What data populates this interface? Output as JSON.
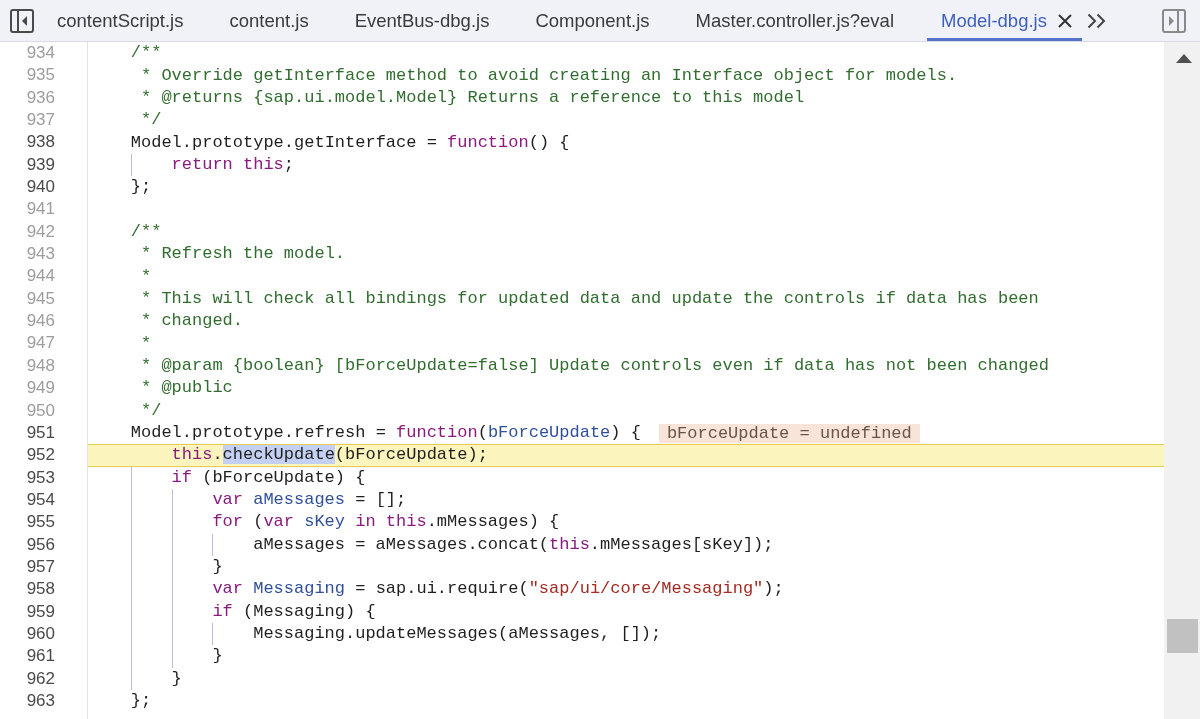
{
  "tabs": [
    {
      "label": "contentScript.js",
      "selected": false
    },
    {
      "label": "content.js",
      "selected": false
    },
    {
      "label": "EventBus-dbg.js",
      "selected": false
    },
    {
      "label": "Component.js",
      "selected": false
    },
    {
      "label": "Master.controller.js?eval",
      "selected": false
    },
    {
      "label": "Model-dbg.js",
      "selected": true
    }
  ],
  "editor": {
    "lines": [
      {
        "number": "934",
        "dimmed": true,
        "current": false,
        "code": [
          {
            "kind": "comment",
            "text": "    /**"
          }
        ]
      },
      {
        "number": "935",
        "dimmed": true,
        "current": false,
        "code": [
          {
            "kind": "comment",
            "text": "     * Override getInterface method to avoid creating an Interface object for models."
          }
        ]
      },
      {
        "number": "936",
        "dimmed": true,
        "current": false,
        "code": [
          {
            "kind": "comment",
            "text": "     * @returns {sap.ui.model.Model} Returns a reference to this model"
          }
        ]
      },
      {
        "number": "937",
        "dimmed": true,
        "current": false,
        "code": [
          {
            "kind": "comment",
            "text": "     */"
          }
        ]
      },
      {
        "number": "938",
        "dimmed": false,
        "current": false,
        "code": [
          {
            "kind": "plain",
            "text": "    Model.prototype.getInterface = "
          },
          {
            "kind": "keyword",
            "text": "function"
          },
          {
            "kind": "plain",
            "text": "() {"
          }
        ]
      },
      {
        "number": "939",
        "dimmed": false,
        "current": false,
        "code": [
          {
            "kind": "keyword",
            "text": "        return this"
          },
          {
            "kind": "plain",
            "text": ";"
          }
        ]
      },
      {
        "number": "940",
        "dimmed": false,
        "current": false,
        "code": [
          {
            "kind": "plain",
            "text": "    };"
          }
        ]
      },
      {
        "number": "941",
        "dimmed": true,
        "current": false
      },
      {
        "number": "942",
        "dimmed": true,
        "current": false,
        "code": [
          {
            "kind": "comment",
            "text": "    /**"
          }
        ]
      },
      {
        "number": "943",
        "dimmed": true,
        "current": false,
        "code": [
          {
            "kind": "comment",
            "text": "     * Refresh the model."
          }
        ]
      },
      {
        "number": "944",
        "dimmed": true,
        "current": false,
        "code": [
          {
            "kind": "comment",
            "text": "     *"
          }
        ]
      },
      {
        "number": "945",
        "dimmed": true,
        "current": false,
        "code": [
          {
            "kind": "comment",
            "text": "     * This will check all bindings for updated data and update the controls if data has been"
          }
        ]
      },
      {
        "number": "946",
        "dimmed": true,
        "current": false,
        "code": [
          {
            "kind": "comment",
            "text": "     * changed."
          }
        ]
      },
      {
        "number": "947",
        "dimmed": true,
        "current": false,
        "code": [
          {
            "kind": "comment",
            "text": "     *"
          }
        ]
      },
      {
        "number": "948",
        "dimmed": true,
        "current": false,
        "code": [
          {
            "kind": "comment",
            "text": "     * @param {boolean} [bForceUpdate=false] Update controls even if data has not been changed"
          }
        ]
      },
      {
        "number": "949",
        "dimmed": true,
        "current": false,
        "code": [
          {
            "kind": "comment",
            "text": "     * @public"
          }
        ]
      },
      {
        "number": "950",
        "dimmed": true,
        "current": false,
        "code": [
          {
            "kind": "comment",
            "text": "     */"
          }
        ]
      },
      {
        "number": "951",
        "dimmed": false,
        "current": false,
        "code": [
          {
            "kind": "plain",
            "text": "    Model.prototype.refresh = "
          },
          {
            "kind": "keyword",
            "text": "function"
          },
          {
            "kind": "plain",
            "text": "("
          },
          {
            "kind": "def",
            "text": "bForceUpdate"
          },
          {
            "kind": "plain",
            "text": ") {"
          }
        ],
        "inline_value": "bForceUpdate = undefined"
      },
      {
        "number": "952",
        "dimmed": false,
        "current": true,
        "code": [
          {
            "kind": "keyword",
            "text": "        this"
          },
          {
            "kind": "plain",
            "text": "."
          },
          {
            "kind": "selection",
            "text": "checkUpdate"
          },
          {
            "kind": "plain",
            "text": "(bForceUpdate);"
          }
        ]
      },
      {
        "number": "953",
        "dimmed": false,
        "current": false,
        "code": [
          {
            "kind": "keyword",
            "text": "        if"
          },
          {
            "kind": "plain",
            "text": " (bForceUpdate) {"
          }
        ]
      },
      {
        "number": "954",
        "dimmed": false,
        "current": false,
        "code": [
          {
            "kind": "keyword",
            "text": "            var "
          },
          {
            "kind": "def",
            "text": "aMessages"
          },
          {
            "kind": "plain",
            "text": " = [];"
          }
        ]
      },
      {
        "number": "955",
        "dimmed": false,
        "current": false,
        "code": [
          {
            "kind": "keyword",
            "text": "            for"
          },
          {
            "kind": "plain",
            "text": " ("
          },
          {
            "kind": "keyword",
            "text": "var "
          },
          {
            "kind": "def",
            "text": "sKey"
          },
          {
            "kind": "keyword",
            "text": " in this"
          },
          {
            "kind": "plain",
            "text": ".mMessages) {"
          }
        ]
      },
      {
        "number": "956",
        "dimmed": false,
        "current": false,
        "code": [
          {
            "kind": "plain",
            "text": "                aMessages = aMessages.concat("
          },
          {
            "kind": "keyword",
            "text": "this"
          },
          {
            "kind": "plain",
            "text": ".mMessages[sKey]);"
          }
        ]
      },
      {
        "number": "957",
        "dimmed": false,
        "current": false,
        "code": [
          {
            "kind": "plain",
            "text": "            }"
          }
        ]
      },
      {
        "number": "958",
        "dimmed": false,
        "current": false,
        "code": [
          {
            "kind": "keyword",
            "text": "            var "
          },
          {
            "kind": "def",
            "text": "Messaging"
          },
          {
            "kind": "plain",
            "text": " = sap.ui.require("
          },
          {
            "kind": "string",
            "text": "\"sap/ui/core/Messaging\""
          },
          {
            "kind": "plain",
            "text": ");"
          }
        ]
      },
      {
        "number": "959",
        "dimmed": false,
        "current": false,
        "code": [
          {
            "kind": "keyword",
            "text": "            if"
          },
          {
            "kind": "plain",
            "text": " (Messaging) {"
          }
        ]
      },
      {
        "number": "960",
        "dimmed": false,
        "current": false,
        "code": [
          {
            "kind": "plain",
            "text": "                Messaging.updateMessages(aMessages, []);"
          }
        ]
      },
      {
        "number": "961",
        "dimmed": false,
        "current": false,
        "code": [
          {
            "kind": "plain",
            "text": "            }"
          }
        ]
      },
      {
        "number": "962",
        "dimmed": false,
        "current": false,
        "code": [
          {
            "kind": "plain",
            "text": "        }"
          }
        ]
      },
      {
        "number": "963",
        "dimmed": false,
        "current": false,
        "code": [
          {
            "kind": "plain",
            "text": "    };"
          }
        ]
      }
    ]
  }
}
